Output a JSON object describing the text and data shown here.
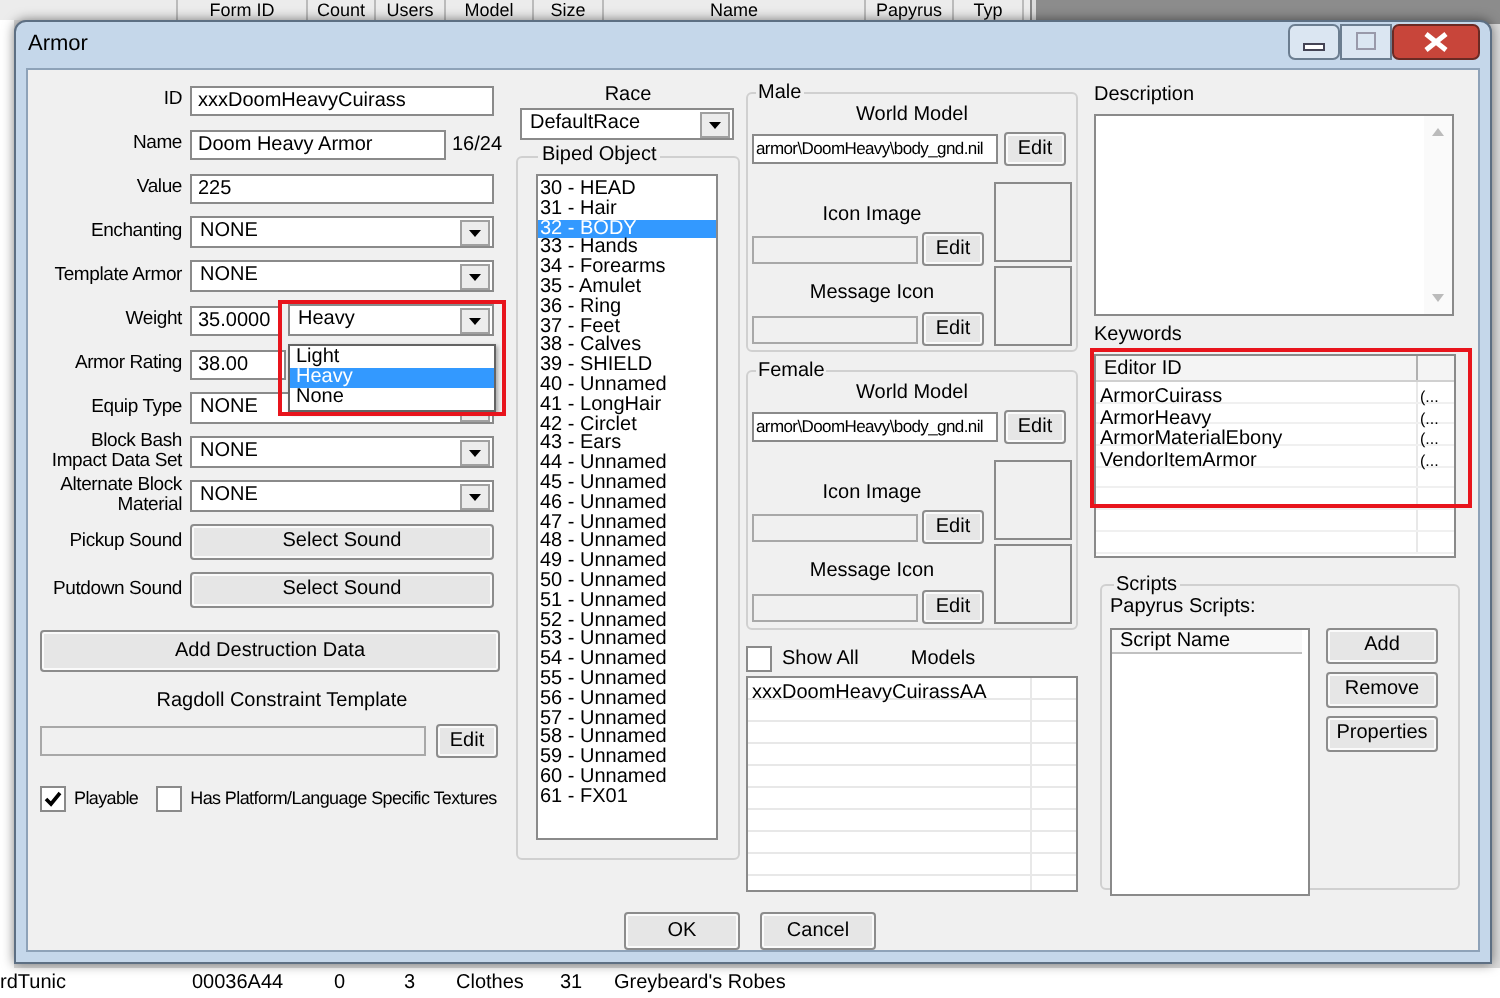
{
  "background_list": {
    "columns": [
      "Form ID",
      "Count",
      "Users",
      "Model",
      "Size",
      "Name",
      "Papyrus",
      "Typ"
    ],
    "row": [
      "rdTunic",
      "00036A44",
      "0",
      "3",
      "Clothes",
      "31",
      "Greybeard's Robes"
    ]
  },
  "window": {
    "title": "Armor"
  },
  "form": [
    {
      "kind": "text",
      "label": "ID",
      "value": "xxxDoomHeavyCuirass"
    },
    {
      "kind": "text",
      "label": "Name",
      "value": "Doom Heavy Armor",
      "counter": "16/24"
    },
    {
      "kind": "text",
      "label": "Value",
      "value": "225"
    },
    {
      "kind": "combo",
      "label": "Enchanting",
      "value": "NONE"
    },
    {
      "kind": "combo",
      "label": "Template Armor",
      "value": "NONE"
    },
    {
      "kind": "weight",
      "label": "Weight",
      "value": "35.0000",
      "type_value": "Heavy",
      "highlighted": true,
      "options": [
        {
          "label": "Light",
          "selected": false
        },
        {
          "label": "Heavy",
          "selected": true
        },
        {
          "label": "None",
          "selected": false
        }
      ]
    },
    {
      "kind": "short_text",
      "label": "Armor Rating",
      "value": "38.00"
    },
    {
      "kind": "combo",
      "label": "Equip Type",
      "value": "NONE"
    },
    {
      "kind": "combo",
      "label": "Block Bash Impact Data Set",
      "value": "NONE"
    },
    {
      "kind": "combo",
      "label": "Alternate Block Material",
      "value": "NONE"
    },
    {
      "kind": "button",
      "label": "Pickup Sound",
      "value": "Select Sound"
    },
    {
      "kind": "button",
      "label": "Putdown Sound",
      "value": "Select Sound"
    }
  ],
  "destruction_button": "Add Destruction Data",
  "ragdoll": {
    "label": "Ragdoll Constraint Template",
    "button": "Edit"
  },
  "checkboxes": [
    {
      "label": "Playable",
      "checked": true
    },
    {
      "label": "Has Platform/Language Specific Textures",
      "checked": false
    }
  ],
  "race": {
    "label": "Race",
    "value": "DefaultRace"
  },
  "biped": {
    "title": "Biped Object",
    "items": [
      {
        "label": "30 - HEAD",
        "selected": false
      },
      {
        "label": "31 - Hair",
        "selected": false
      },
      {
        "label": "32 - BODY",
        "selected": true
      },
      {
        "label": "33 - Hands",
        "selected": false
      },
      {
        "label": "34 - Forearms",
        "selected": false
      },
      {
        "label": "35 - Amulet",
        "selected": false
      },
      {
        "label": "36 - Ring",
        "selected": false
      },
      {
        "label": "37 - Feet",
        "selected": false
      },
      {
        "label": "38 - Calves",
        "selected": false
      },
      {
        "label": "39 - SHIELD",
        "selected": false
      },
      {
        "label": "40 - Unnamed",
        "selected": false
      },
      {
        "label": "41 - LongHair",
        "selected": false
      },
      {
        "label": "42 - Circlet",
        "selected": false
      },
      {
        "label": "43 - Ears",
        "selected": false
      },
      {
        "label": "44 - Unnamed",
        "selected": false
      },
      {
        "label": "45 - Unnamed",
        "selected": false
      },
      {
        "label": "46 - Unnamed",
        "selected": false
      },
      {
        "label": "47 - Unnamed",
        "selected": false
      },
      {
        "label": "48 - Unnamed",
        "selected": false
      },
      {
        "label": "49 - Unnamed",
        "selected": false
      },
      {
        "label": "50 - Unnamed",
        "selected": false
      },
      {
        "label": "51 - Unnamed",
        "selected": false
      },
      {
        "label": "52 - Unnamed",
        "selected": false
      },
      {
        "label": "53 - Unnamed",
        "selected": false
      },
      {
        "label": "54 - Unnamed",
        "selected": false
      },
      {
        "label": "55 - Unnamed",
        "selected": false
      },
      {
        "label": "56 - Unnamed",
        "selected": false
      },
      {
        "label": "57 - Unnamed",
        "selected": false
      },
      {
        "label": "58 - Unnamed",
        "selected": false
      },
      {
        "label": "59 - Unnamed",
        "selected": false
      },
      {
        "label": "60 - Unnamed",
        "selected": false
      },
      {
        "label": "61 - FX01",
        "selected": false
      }
    ]
  },
  "models_groups": [
    {
      "title": "Male",
      "world_model_label": "World Model",
      "world_model": "armor\\DoomHeavy\\body_gnd.nil",
      "world_edit": "Edit",
      "icon_label": "Icon Image",
      "icon_edit": "Edit",
      "message_label": "Message Icon",
      "message_edit": "Edit"
    },
    {
      "title": "Female",
      "world_model_label": "World Model",
      "world_model": "armor\\DoomHeavy\\body_gnd.nil",
      "world_edit": "Edit",
      "icon_label": "Icon Image",
      "icon_edit": "Edit",
      "message_label": "Message Icon",
      "message_edit": "Edit"
    }
  ],
  "models": {
    "show_all": {
      "label": "Show All",
      "checked": false
    },
    "title": "Models",
    "items": [
      "xxxDoomHeavyCuirassAA"
    ]
  },
  "description": {
    "label": "Description"
  },
  "keywords": {
    "label": "Keywords",
    "column": "Editor ID",
    "highlighted": true,
    "items": [
      {
        "editor_id": "ArmorCuirass",
        "column_2": "(..."
      },
      {
        "editor_id": "ArmorHeavy",
        "column_2": "(..."
      },
      {
        "editor_id": "ArmorMaterialEbony",
        "column_2": "(..."
      },
      {
        "editor_id": "VendorItemArmor",
        "column_2": "(..."
      }
    ]
  },
  "scripts": {
    "title": "Scripts",
    "label": "Papyrus Scripts:",
    "column": "Script Name",
    "buttons": [
      "Add",
      "Remove",
      "Properties"
    ]
  },
  "buttons": [
    "OK",
    "Cancel"
  ]
}
